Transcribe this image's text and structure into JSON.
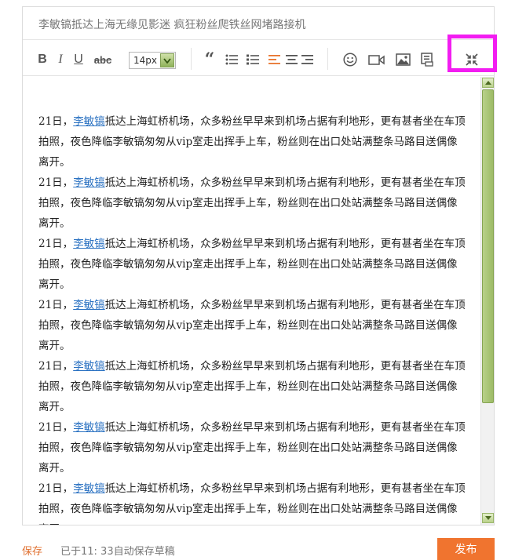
{
  "editor": {
    "title": "李敏镐抵达上海无缘见影迷 疯狂粉丝爬铁丝网堵路接机"
  },
  "toolbar": {
    "bold_label": "B",
    "italic_label": "I",
    "underline_label": "U",
    "strike_label": "abc",
    "font_size": "14px",
    "quote_label": "“",
    "icons": [
      "bold-icon",
      "italic-icon",
      "underline-icon",
      "strikethrough-icon",
      "font-size-select",
      "quote-icon",
      "bullet-list-icon",
      "numbered-list-icon",
      "align-left-icon",
      "align-center-icon",
      "align-right-icon",
      "emoji-icon",
      "video-icon",
      "image-icon",
      "template-icon",
      "exit-fullscreen-icon"
    ],
    "accent_color": "#e8742e"
  },
  "content": {
    "paragraph": {
      "prefix": "21日，",
      "link": "李敏镐",
      "line1_rest": "抵达上海虹桥机场，众多粉丝早早来到机场占据有利地形，更有甚者坐在车顶",
      "line2": "拍照，夜色降临李敏镐匆匆从vip室走出挥手上车，粉丝则在出口处站满整条马路目送偶像",
      "line3": "离开。"
    },
    "repeat_count_visible": 7
  },
  "footer": {
    "save_label": "保存",
    "autosave_text": "已于11: 33自动保存草稿",
    "publish_label": "发布"
  },
  "colors": {
    "link": "#2b72c2",
    "publish_bg": "#f0742f",
    "highlight": "#f21df1",
    "scrollbar": "#9dbb66"
  }
}
